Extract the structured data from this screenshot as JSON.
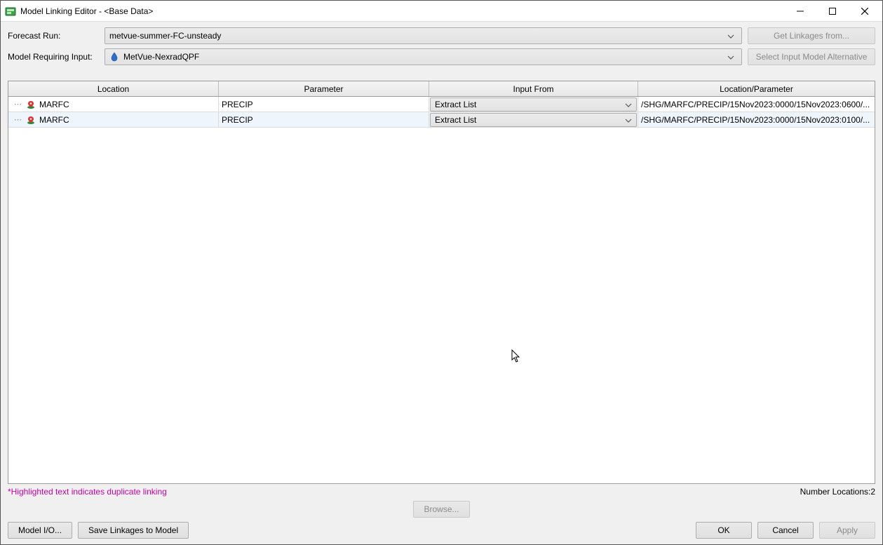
{
  "window": {
    "title": "Model Linking Editor - <Base Data>"
  },
  "form": {
    "forecast_label": "Forecast Run:",
    "forecast_value": "metvue-summer-FC-unsteady",
    "model_input_label": "Model Requiring Input:",
    "model_input_value": "MetVue-NexradQPF",
    "get_linkages_btn": "Get Linkages from...",
    "select_alt_btn": "Select Input Model Alternative"
  },
  "table": {
    "headers": {
      "location": "Location",
      "parameter": "Parameter",
      "input_from": "Input From",
      "location_parameter": "Location/Parameter"
    },
    "rows": [
      {
        "location": "MARFC",
        "parameter": "PRECIP",
        "input_from": "Extract List",
        "location_parameter": "/SHG/MARFC/PRECIP/15Nov2023:0000/15Nov2023:0600/..."
      },
      {
        "location": "MARFC",
        "parameter": "PRECIP",
        "input_from": "Extract List",
        "location_parameter": "/SHG/MARFC/PRECIP/15Nov2023:0000/15Nov2023:0100/..."
      }
    ]
  },
  "status": {
    "highlight_note": "*Highlighted text indicates duplicate linking",
    "count_label": "Number Locations:2"
  },
  "buttons": {
    "browse": "Browse...",
    "model_io": "Model I/O...",
    "save_linkages": "Save Linkages to Model",
    "ok": "OK",
    "cancel": "Cancel",
    "apply": "Apply"
  }
}
